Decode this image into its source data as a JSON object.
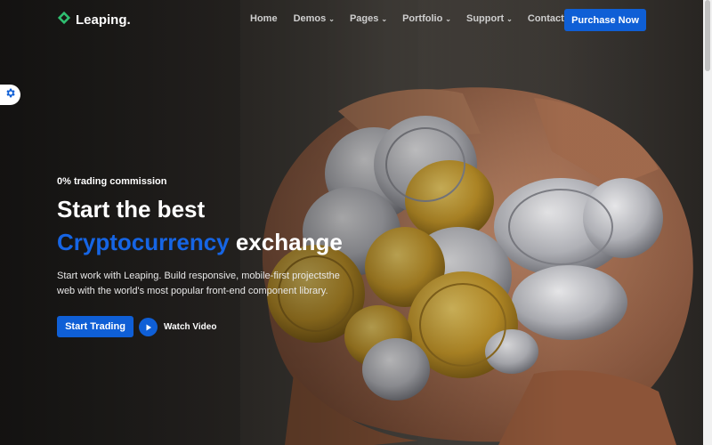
{
  "brand": {
    "name": "Leaping."
  },
  "nav": {
    "items": [
      {
        "label": "Home",
        "dropdown": false
      },
      {
        "label": "Demos",
        "dropdown": true
      },
      {
        "label": "Pages",
        "dropdown": true
      },
      {
        "label": "Portfolio",
        "dropdown": true
      },
      {
        "label": "Support",
        "dropdown": true
      },
      {
        "label": "Contact",
        "dropdown": false
      }
    ],
    "cta_label": "Purchase Now"
  },
  "hero": {
    "tagline": "0% trading commission",
    "headline_line1": "Start the best",
    "headline_accent": "Cryptocurrency",
    "headline_rest": " exchange",
    "description": "Start work with Leaping. Build responsive, mobile-first projectsthe web with the world's most popular front-end component library.",
    "primary_button": "Start Trading",
    "video_label": "Watch Video"
  },
  "icons": {
    "logo": "diamond-logo-icon",
    "settings": "gear-icon",
    "play": "play-icon",
    "dropdown": "chevron-down-icon"
  },
  "colors": {
    "accent": "#1665e4",
    "button": "#0f5fd6",
    "logo_green": "#2fbf71"
  }
}
